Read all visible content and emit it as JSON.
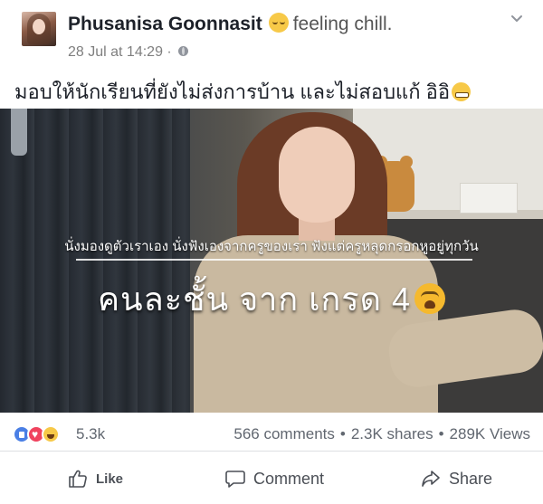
{
  "post": {
    "author_name": "Phusanisa Goonnasit",
    "feeling": "feeling chill.",
    "timestamp": "28 Jul at 14:29",
    "meta_separator": "·",
    "caption": "มอบให้นักเรียนที่ยังไม่ส่งการบ้าน และไม่สอบแก้ อิอิ"
  },
  "video": {
    "subtitle_small": "นั่งมองดูตัวเราเอง นั่งฟังเองจากครูของเรา ฟังแต่ครูหลุดกรอกหูอยู่ทุกวัน",
    "subtitle_big": "คนละชั้น จาก เกรด 4"
  },
  "stats": {
    "reactions_count": "5.3k",
    "comments": "566 comments",
    "shares": "2.3K shares",
    "views": "289K Views",
    "separator": "•"
  },
  "actions": {
    "like_label": "Like",
    "comment_label": "Comment",
    "share_label": "Share"
  },
  "colors": {
    "like_blue": "#4a7fe5",
    "love_red": "#f0435e",
    "haha_yellow": "#f7c948",
    "muted_text": "#616770"
  }
}
